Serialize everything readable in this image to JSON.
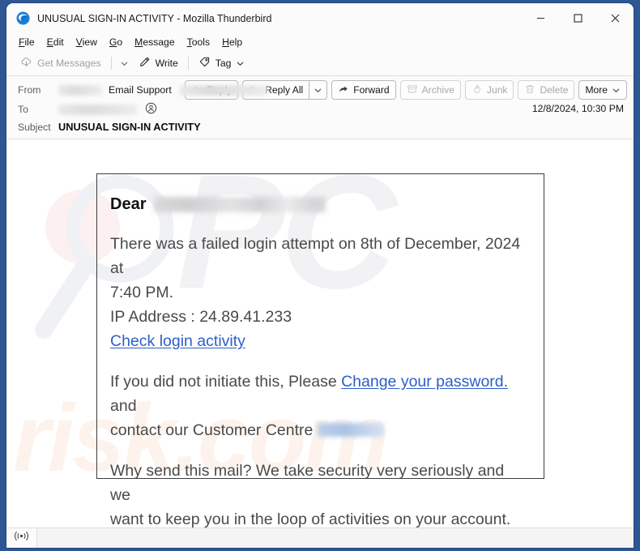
{
  "window": {
    "title": "UNUSUAL SIGN-IN ACTIVITY - Mozilla Thunderbird",
    "app_icon": "thunderbird-logo-icon",
    "controls": {
      "minimize": "minimize-icon",
      "maximize": "maximize-icon",
      "close": "close-icon"
    }
  },
  "menubar": {
    "items": [
      {
        "label": "File",
        "accel": "F"
      },
      {
        "label": "Edit",
        "accel": "E"
      },
      {
        "label": "View",
        "accel": "V"
      },
      {
        "label": "Go",
        "accel": "G"
      },
      {
        "label": "Message",
        "accel": "M"
      },
      {
        "label": "Tools",
        "accel": "T"
      },
      {
        "label": "Help",
        "accel": "H"
      }
    ]
  },
  "toolbar": {
    "get_messages_label": "Get Messages",
    "write_label": "Write",
    "tag_label": "Tag"
  },
  "message_header": {
    "from_label": "From",
    "from_name": "Email Support",
    "to_label": "To",
    "subject_label": "Subject",
    "subject_value": "UNUSUAL SIGN-IN ACTIVITY",
    "date": "12/8/2024, 10:30 PM",
    "buttons": {
      "reply": "Reply",
      "reply_all": "Reply All",
      "forward": "Forward",
      "archive": "Archive",
      "junk": "Junk",
      "delete": "Delete",
      "more": "More"
    }
  },
  "email_body": {
    "greeting_word": "Dear",
    "paragraph_1_line_1": "There was a failed login attempt on 8th of December, 2024 at",
    "paragraph_1_line_2": "7:40 PM.",
    "ip_line": "IP Address : 24.89.41.233",
    "check_link": "Check login activity",
    "paragraph_2_prefix": "If you did not initiate this, Please ",
    "paragraph_2_link": "Change your password.",
    "paragraph_2_suffix": " and",
    "paragraph_2_line_2": "contact our Customer Centre",
    "paragraph_3_line_1": "Why send this mail? We take security very seriously and we",
    "paragraph_3_line_2": "want to keep you in the loop of activities on your account."
  },
  "watermark": {
    "text_primary": "PC",
    "text_secondary": "risk.com"
  },
  "statusbar": {
    "connection_icon": "network-activity-icon"
  },
  "colors": {
    "desktop": "#2d5793",
    "chrome": "#fbfbfb",
    "link": "#2c5fc9",
    "body_text": "#4a4a4a",
    "accent_border": "#3c3c3c"
  }
}
